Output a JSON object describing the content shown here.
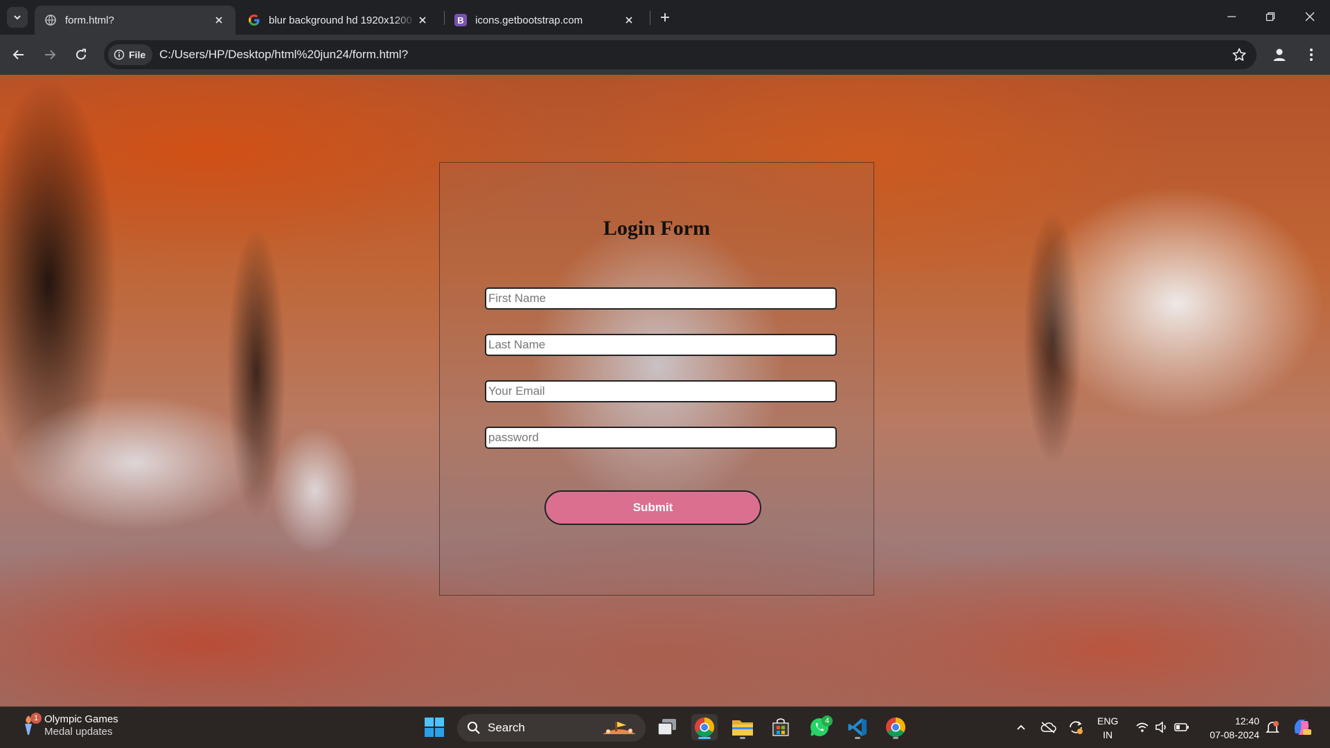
{
  "browser": {
    "tabs": [
      {
        "title": "form.html?",
        "icon": "globe-icon",
        "active": true
      },
      {
        "title": "blur background hd 1920x1200",
        "icon": "google-icon",
        "active": false
      },
      {
        "title": "icons.getbootstrap.com",
        "icon": "bootstrap-icon",
        "active": false
      }
    ],
    "bootstrap_favicon_letter": "B",
    "address_chip": "File",
    "url": "C:/Users/HP/Desktop/html%20jun24/form.html?"
  },
  "form": {
    "title": "Login Form",
    "fields": {
      "first_name": {
        "placeholder": "First Name",
        "value": ""
      },
      "last_name": {
        "placeholder": "Last Name",
        "value": ""
      },
      "email": {
        "placeholder": "Your Email",
        "value": ""
      },
      "password": {
        "placeholder": "password",
        "value": ""
      }
    },
    "submit_label": "Submit",
    "accent_color": "#db6f8f"
  },
  "taskbar": {
    "widget": {
      "title": "Olympic Games",
      "subtitle": "Medal updates",
      "badge": "1"
    },
    "search_label": "Search",
    "whatsapp_badge": "4",
    "language": {
      "line1": "ENG",
      "line2": "IN"
    },
    "time": "12:40",
    "date": "07-08-2024"
  }
}
